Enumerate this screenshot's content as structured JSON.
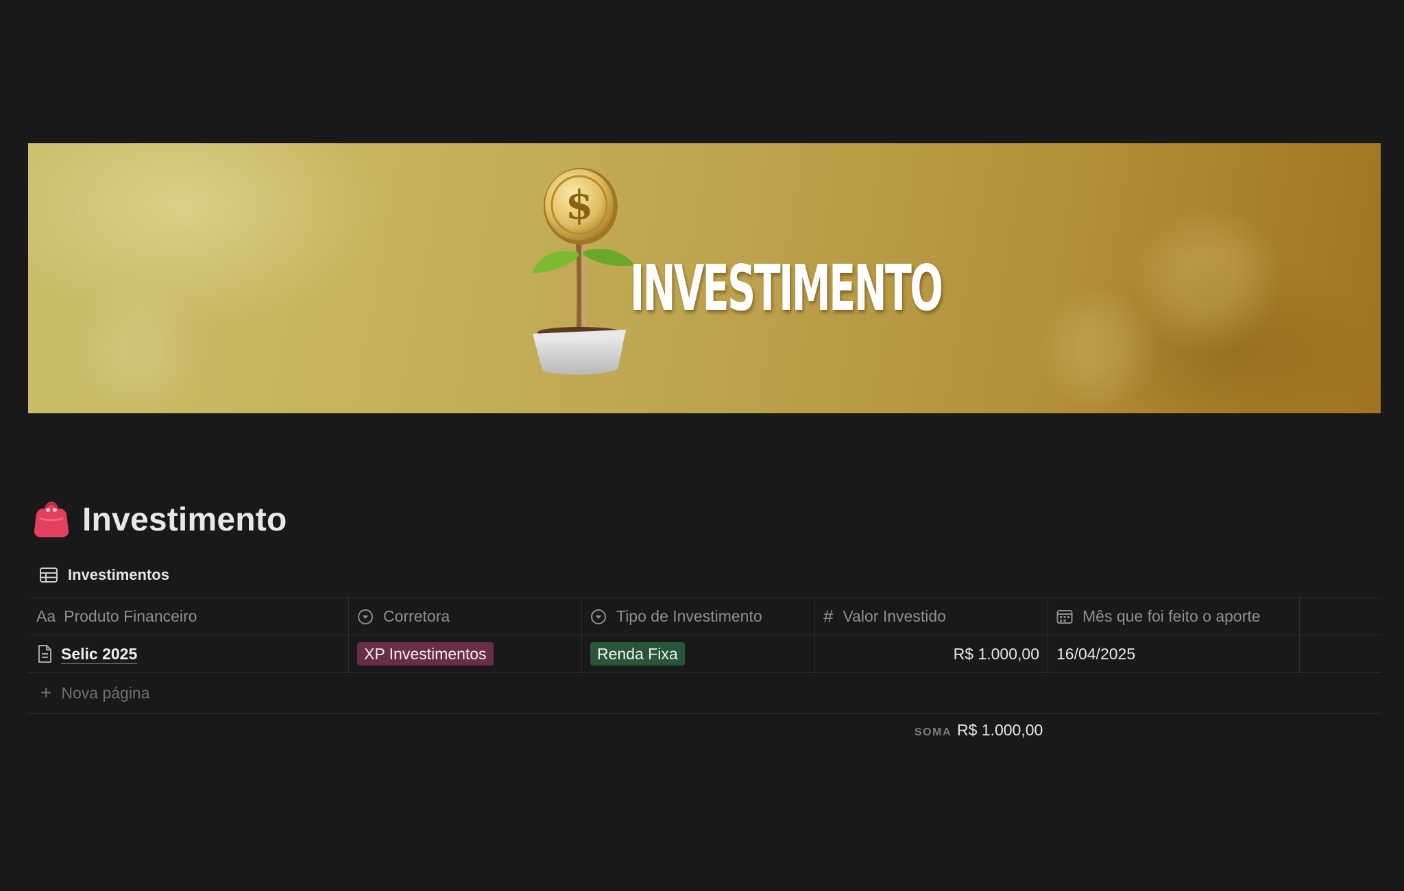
{
  "cover": {
    "title": "INVESTIMENTO",
    "plant_icon": "coin-plant-icon"
  },
  "page": {
    "icon": "purse-icon",
    "title": "Investimento"
  },
  "view": {
    "icon": "table-icon",
    "label": "Investimentos"
  },
  "table": {
    "columns": [
      {
        "icon": "Aa",
        "label": "Produto Financeiro"
      },
      {
        "icon": "select-icon",
        "label": "Corretora"
      },
      {
        "icon": "select-icon",
        "label": "Tipo de Investimento"
      },
      {
        "icon": "#",
        "label": "Valor Investido"
      },
      {
        "icon": "calendar-icon",
        "label": "Mês que foi feito o aporte"
      }
    ],
    "rows": [
      {
        "name": "Selic 2025",
        "corretora": "XP Investimentos",
        "tipo": "Renda Fixa",
        "valor": "R$ 1.000,00",
        "data": "16/04/2025"
      }
    ],
    "new_page_label": "Nova página",
    "summary": {
      "label": "SOMA",
      "value": "R$ 1.000,00"
    }
  },
  "colors": {
    "background": "#191919",
    "tag_purple": "#6a2d48",
    "tag_green": "#27563b",
    "cover_gold": "#bfa44f"
  }
}
